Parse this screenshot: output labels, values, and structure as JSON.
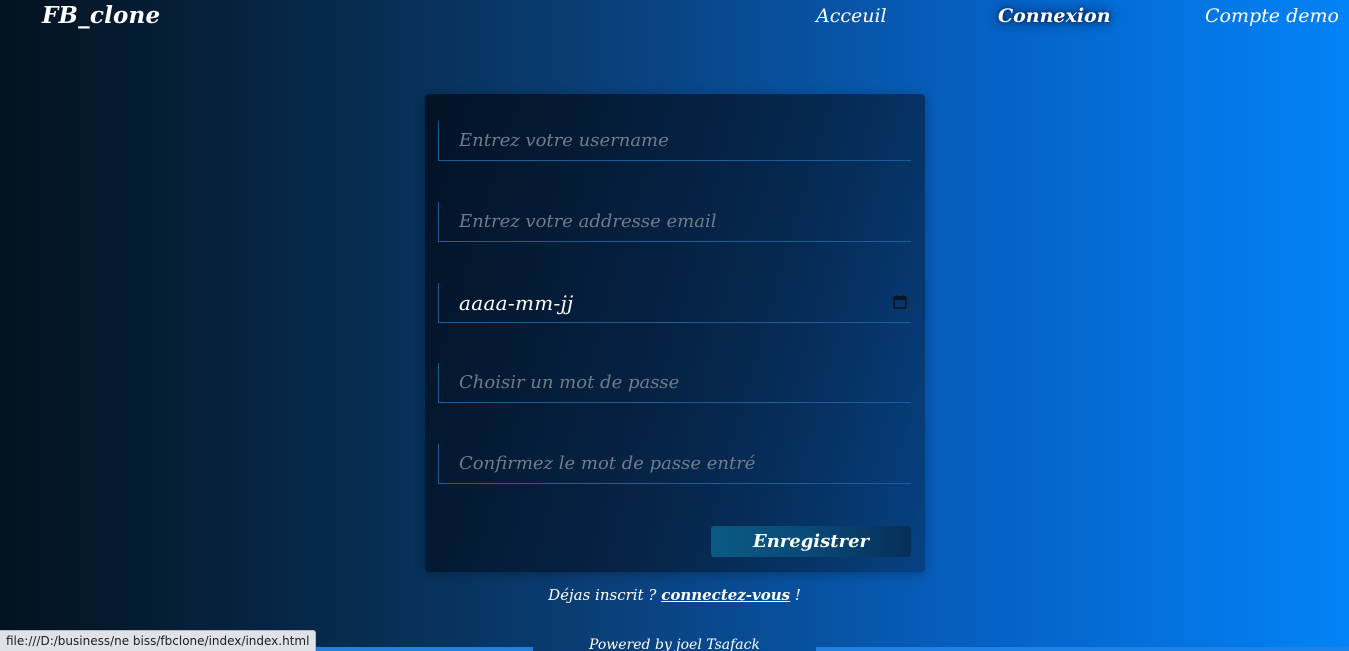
{
  "navbar": {
    "brand": "FB_clone",
    "links": [
      "Acceuil",
      "Connexion",
      "Compte demo"
    ],
    "active_link": "Connexion"
  },
  "form": {
    "username_placeholder": "Entrez votre username",
    "email_placeholder": "Entrez votre addresse email",
    "date_placeholder": "aaaa-mm-jj",
    "password_placeholder": "Choisir un mot de passe",
    "confirm_placeholder": "Confirmez le mot de passe entré",
    "submit_label": "Enregistrer",
    "calendar_icon": "calendar-icon"
  },
  "login_prompt": {
    "text_before": "Déjas inscrit ? ",
    "link": "connectez-vous",
    "text_after": " !"
  },
  "footer": {
    "powered_by": "Powered by joel Tsafack"
  },
  "browser_status": {
    "url": "file:///D:/business/ne biss/fbclone/index/index.html"
  },
  "colors": {
    "background_left": "#03121f",
    "background_right": "#0283f8",
    "field_border": "#1c5d97",
    "button": "#094b79",
    "footer_bar": "#1c80e6"
  }
}
